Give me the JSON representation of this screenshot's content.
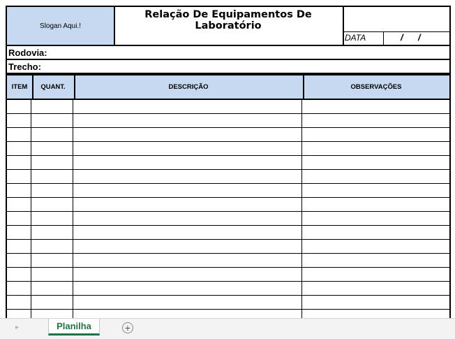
{
  "sheet": {
    "logo_text": "Slogan Aqui.!",
    "title": "Relação De Equipamentos De Laboratório",
    "date_label": "DATA",
    "date_slash_1": "/",
    "date_slash_2": "/",
    "rodovia_label": "Rodovia:",
    "trecho_label": "Trecho:",
    "columns": [
      "ITEM",
      "QUANT.",
      "DESCRIÇÃO",
      "OBSERVAÇÕES"
    ]
  },
  "tabs": {
    "active_tab": "Planilha",
    "add_icon": "+"
  }
}
